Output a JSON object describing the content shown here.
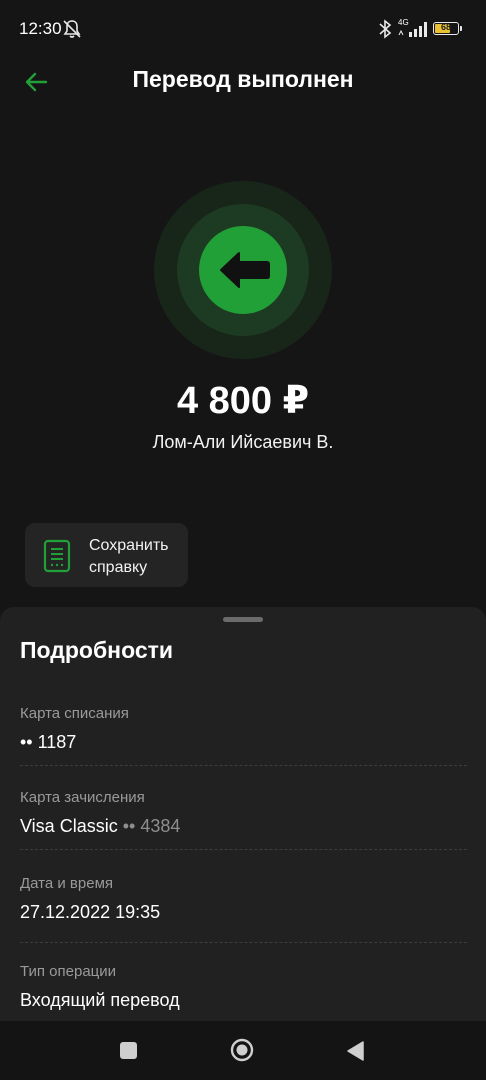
{
  "status_bar": {
    "time": "12:30",
    "network": "4G",
    "battery": "68",
    "battery_level_percent": 68
  },
  "header": {
    "title": "Перевод выполнен"
  },
  "transfer": {
    "amount": "4 800 ₽",
    "recipient": "Лом-Али Ийсаевич В."
  },
  "actions": {
    "save_receipt_label": "Сохранить справку"
  },
  "details": {
    "title": "Подробности",
    "debit_card_label": "Карта списания",
    "debit_card_value": "•• 1187",
    "credit_card_label": "Карта зачисления",
    "credit_card_name": "Visa Classic",
    "credit_card_number": "•• 4384",
    "datetime_label": "Дата и время",
    "datetime_value": "27.12.2022 19:35",
    "operation_type_label": "Тип операции",
    "operation_type_value": "Входящий перевод"
  },
  "colors": {
    "accent_green": "#21a038",
    "background": "#151515",
    "sheet": "#212121"
  },
  "icons": {
    "back": "arrow-left-icon",
    "hero": "arrow-left-bold-icon",
    "receipt": "document-icon",
    "mute": "bell-off-icon",
    "bluetooth": "bluetooth-icon"
  }
}
